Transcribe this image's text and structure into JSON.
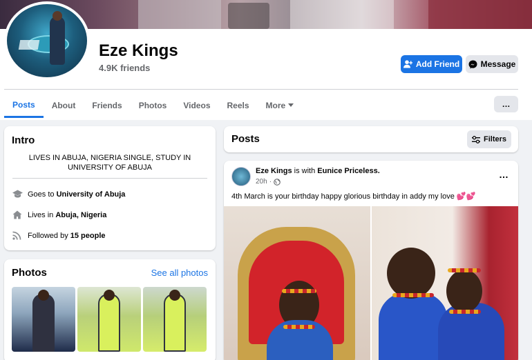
{
  "profile": {
    "name": "Eze Kings",
    "friends_count": "4.9K friends"
  },
  "actions": {
    "add_friend": "Add Friend",
    "message": "Message",
    "more": "…"
  },
  "tabs": [
    {
      "label": "Posts",
      "active": true
    },
    {
      "label": "About"
    },
    {
      "label": "Friends"
    },
    {
      "label": "Photos"
    },
    {
      "label": "Videos"
    },
    {
      "label": "Reels"
    },
    {
      "label": "More"
    }
  ],
  "intro": {
    "title": "Intro",
    "bio": "LIVES IN ABUJA, NIGERIA SINGLE, STUDY IN UNIVERSITY OF ABUJA",
    "rows": [
      {
        "icon": "graduation-cap-icon",
        "prefix": "Goes to",
        "value": "University of Abuja"
      },
      {
        "icon": "home-icon",
        "prefix": "Lives in",
        "value": "Abuja, Nigeria"
      },
      {
        "icon": "rss-icon",
        "prefix": "Followed by",
        "value": "15 people"
      }
    ]
  },
  "photos": {
    "title": "Photos",
    "see_all": "See all photos"
  },
  "posts_header": {
    "title": "Posts",
    "filters": "Filters"
  },
  "post": {
    "author": "Eze Kings",
    "with_text": "is with",
    "tagged": "Eunice Priceless.",
    "time": "20h",
    "separator": "·",
    "text": "4th March is your birthday happy glorious birthday in addy my love",
    "hearts": "💕💕",
    "more": "…"
  },
  "colors": {
    "accent": "#1b74e4",
    "background": "#f0f2f5"
  }
}
